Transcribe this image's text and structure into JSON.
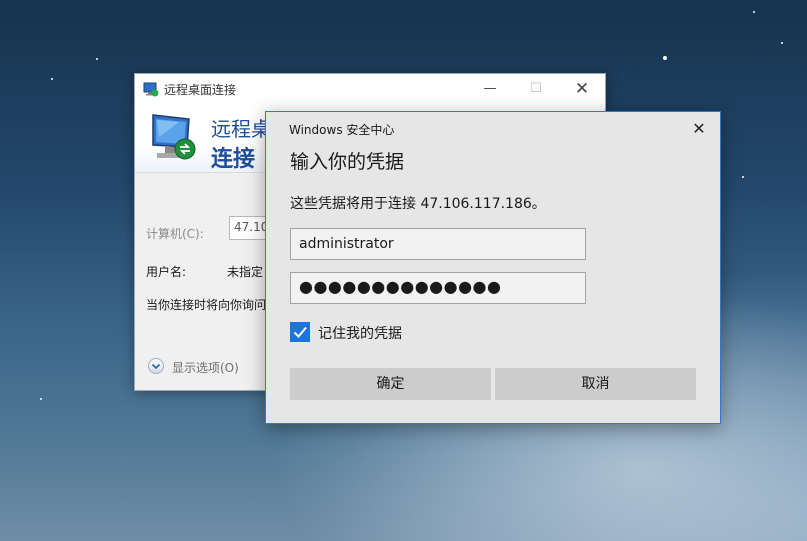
{
  "rdp_window": {
    "title": "远程桌面连接",
    "banner_line1": "远程桌",
    "banner_line2": "连接",
    "computer_label": "计算机(C):",
    "computer_value": "47.10",
    "username_label": "用户名:",
    "username_value": "未指定",
    "prompt_text": "当你连接时将向你询问",
    "show_options_label": "显示选项(O)"
  },
  "credential_dialog": {
    "caption": "Windows 安全中心",
    "heading": "输入你的凭据",
    "description": "这些凭据将用于连接 47.106.117.186。",
    "username_value": "administrator",
    "password_mask": "●●●●●●●●●●●●●●",
    "remember_label": "记住我的凭据",
    "remember_checked": true,
    "ok_label": "确定",
    "cancel_label": "取消"
  },
  "icons": {
    "window_close": "close-icon",
    "window_minimize": "minimize-icon",
    "window_maximize": "maximize-icon",
    "rdp_app": "remote-desktop-icon",
    "options": "chevron-down-icon",
    "check": "checkmark-icon"
  },
  "colors": {
    "accent": "#1c75d8",
    "rdp_banner_text": "#1f4e9a",
    "dialog_background": "#e6e6e6",
    "button_background": "#cccccc"
  }
}
